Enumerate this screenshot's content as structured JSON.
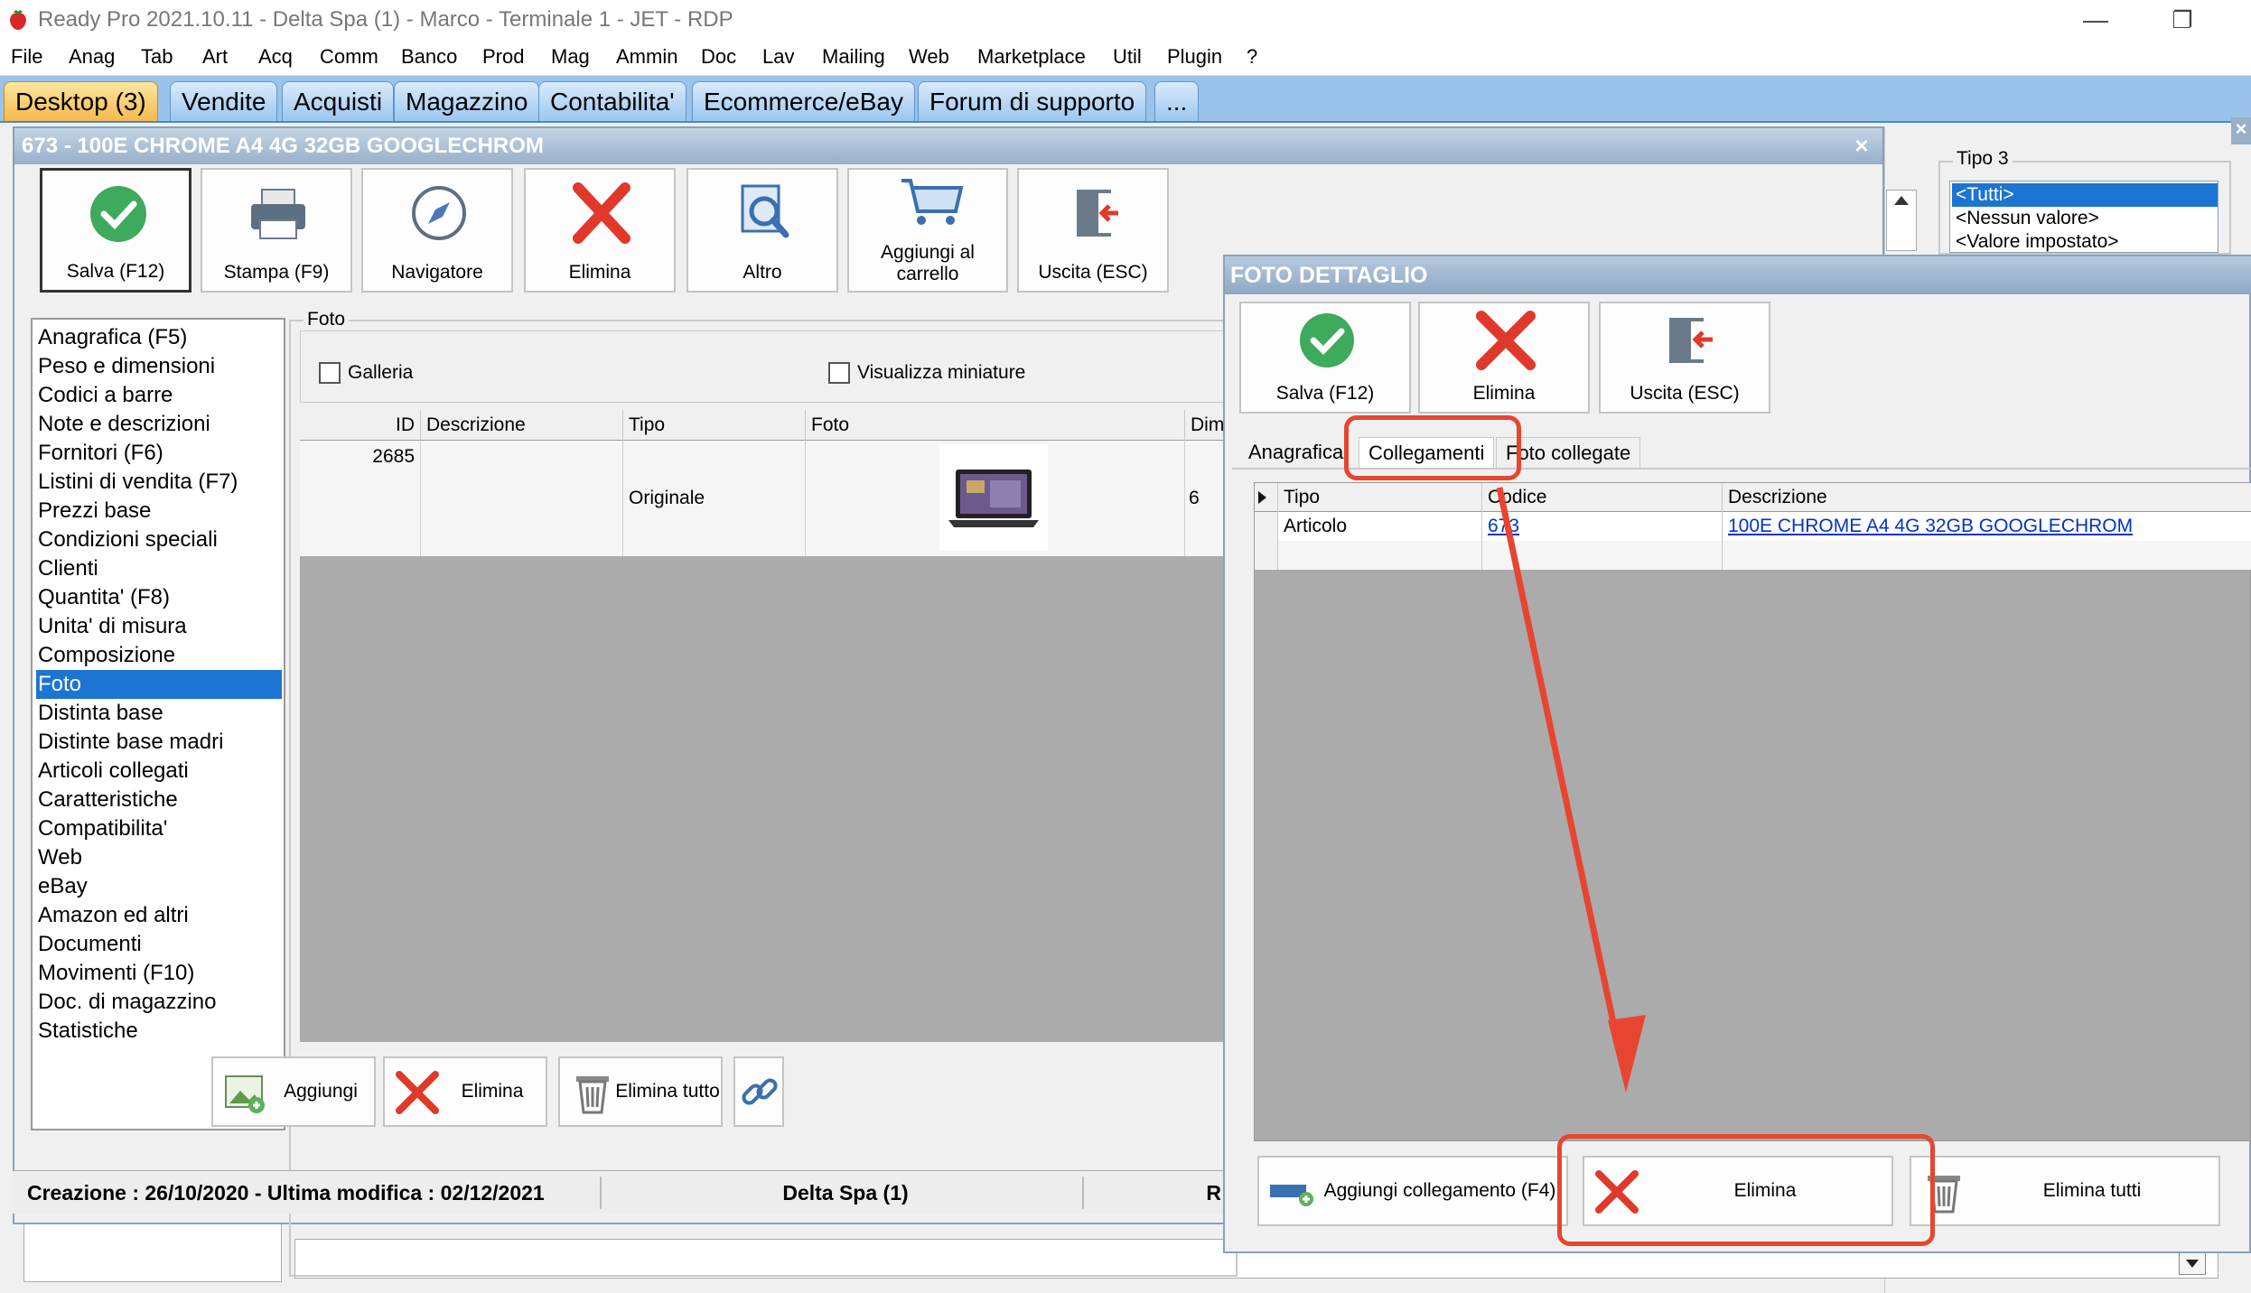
{
  "window": {
    "title": "Ready Pro 2021.10.11 - Delta Spa (1) - Marco - Terminale 1 - JET - RDP",
    "minimize": "—",
    "restore": "❐"
  },
  "menu": [
    "File",
    "Anag",
    "Tab",
    "Art",
    "Acq",
    "Comm",
    "Banco",
    "Prod",
    "Mag",
    "Ammin",
    "Doc",
    "Lav",
    "Mailing",
    "Web",
    "Marketplace",
    "Util",
    "Plugin",
    "?"
  ],
  "desktop_tabs": [
    "Desktop (3)",
    "Vendite",
    "Acquisti",
    "Magazzino",
    "Contabilita'",
    "Ecommerce/eBay",
    "Forum di supporto",
    "..."
  ],
  "article_window": {
    "title": "673 - 100E CHROME A4 4G 32GB GOOGLECHROM",
    "close": "×",
    "toolbar": {
      "save": "Salva (F12)",
      "print": "Stampa (F9)",
      "navigator": "Navigatore",
      "delete": "Elimina",
      "other": "Altro",
      "cart": "Aggiungi al carrello",
      "exit": "Uscita (ESC)"
    },
    "nav_items": [
      "Anagrafica (F5)",
      "Peso e dimensioni",
      "Codici a barre",
      "Note e descrizioni",
      "Fornitori (F6)",
      "Listini di vendita (F7)",
      "Prezzi base",
      "Condizioni speciali",
      "Clienti",
      "Quantita' (F8)",
      "Unita' di misura",
      "Composizione",
      "Foto",
      "Distinta base",
      "Distinte base madri",
      "Articoli collegati",
      "Caratteristiche",
      "Compatibilita'",
      "Web",
      "eBay",
      "Amazon ed altri",
      "Documenti",
      "Movimenti (F10)",
      "Doc. di magazzino",
      "Statistiche"
    ],
    "nav_selected": "Foto",
    "foto": {
      "legend": "Foto",
      "gallery": "Galleria",
      "thumbnails": "Visualizza miniature",
      "columns": [
        "ID",
        "Descrizione",
        "Tipo",
        "Foto",
        "Dime"
      ],
      "row": {
        "id": "2685",
        "descrizione": "",
        "tipo": "Originale",
        "dim": "6"
      },
      "buttons": {
        "add": "Aggiungi",
        "delete": "Elimina",
        "delete_all": "Elimina tutto"
      }
    },
    "status": {
      "dates": "Creazione : 26/10/2020 - Ultima modifica : 02/12/2021",
      "company": "Delta Spa (1)",
      "extra": "R"
    }
  },
  "tipo3": {
    "legend": "Tipo 3",
    "items": [
      "<Tutti>",
      "<Nessun valore>",
      "<Valore impostato>"
    ],
    "selected": "<Tutti>"
  },
  "dialog": {
    "title": "FOTO DETTAGLIO",
    "toolbar": {
      "save": "Salva (F12)",
      "delete": "Elimina",
      "exit": "Uscita (ESC)"
    },
    "tabs": [
      "Anagrafica",
      "Collegamenti",
      "Foto collegate"
    ],
    "active_tab": "Collegamenti",
    "columns": [
      "Tipo",
      "Codice",
      "Descrizione"
    ],
    "row": {
      "tipo": "Articolo",
      "codice": "673",
      "descrizione": "100E CHROME A4 4G 32GB GOOGLECHROM"
    },
    "buttons": {
      "add_link": "Aggiungi collegamento (F4)",
      "delete": "Elimina",
      "delete_all": "Elimina tutti"
    }
  },
  "colors": {
    "accent": "#1c74d3",
    "annotation": "#e84530",
    "ok_green": "#3daa5c",
    "delete_red": "#e0392b"
  }
}
